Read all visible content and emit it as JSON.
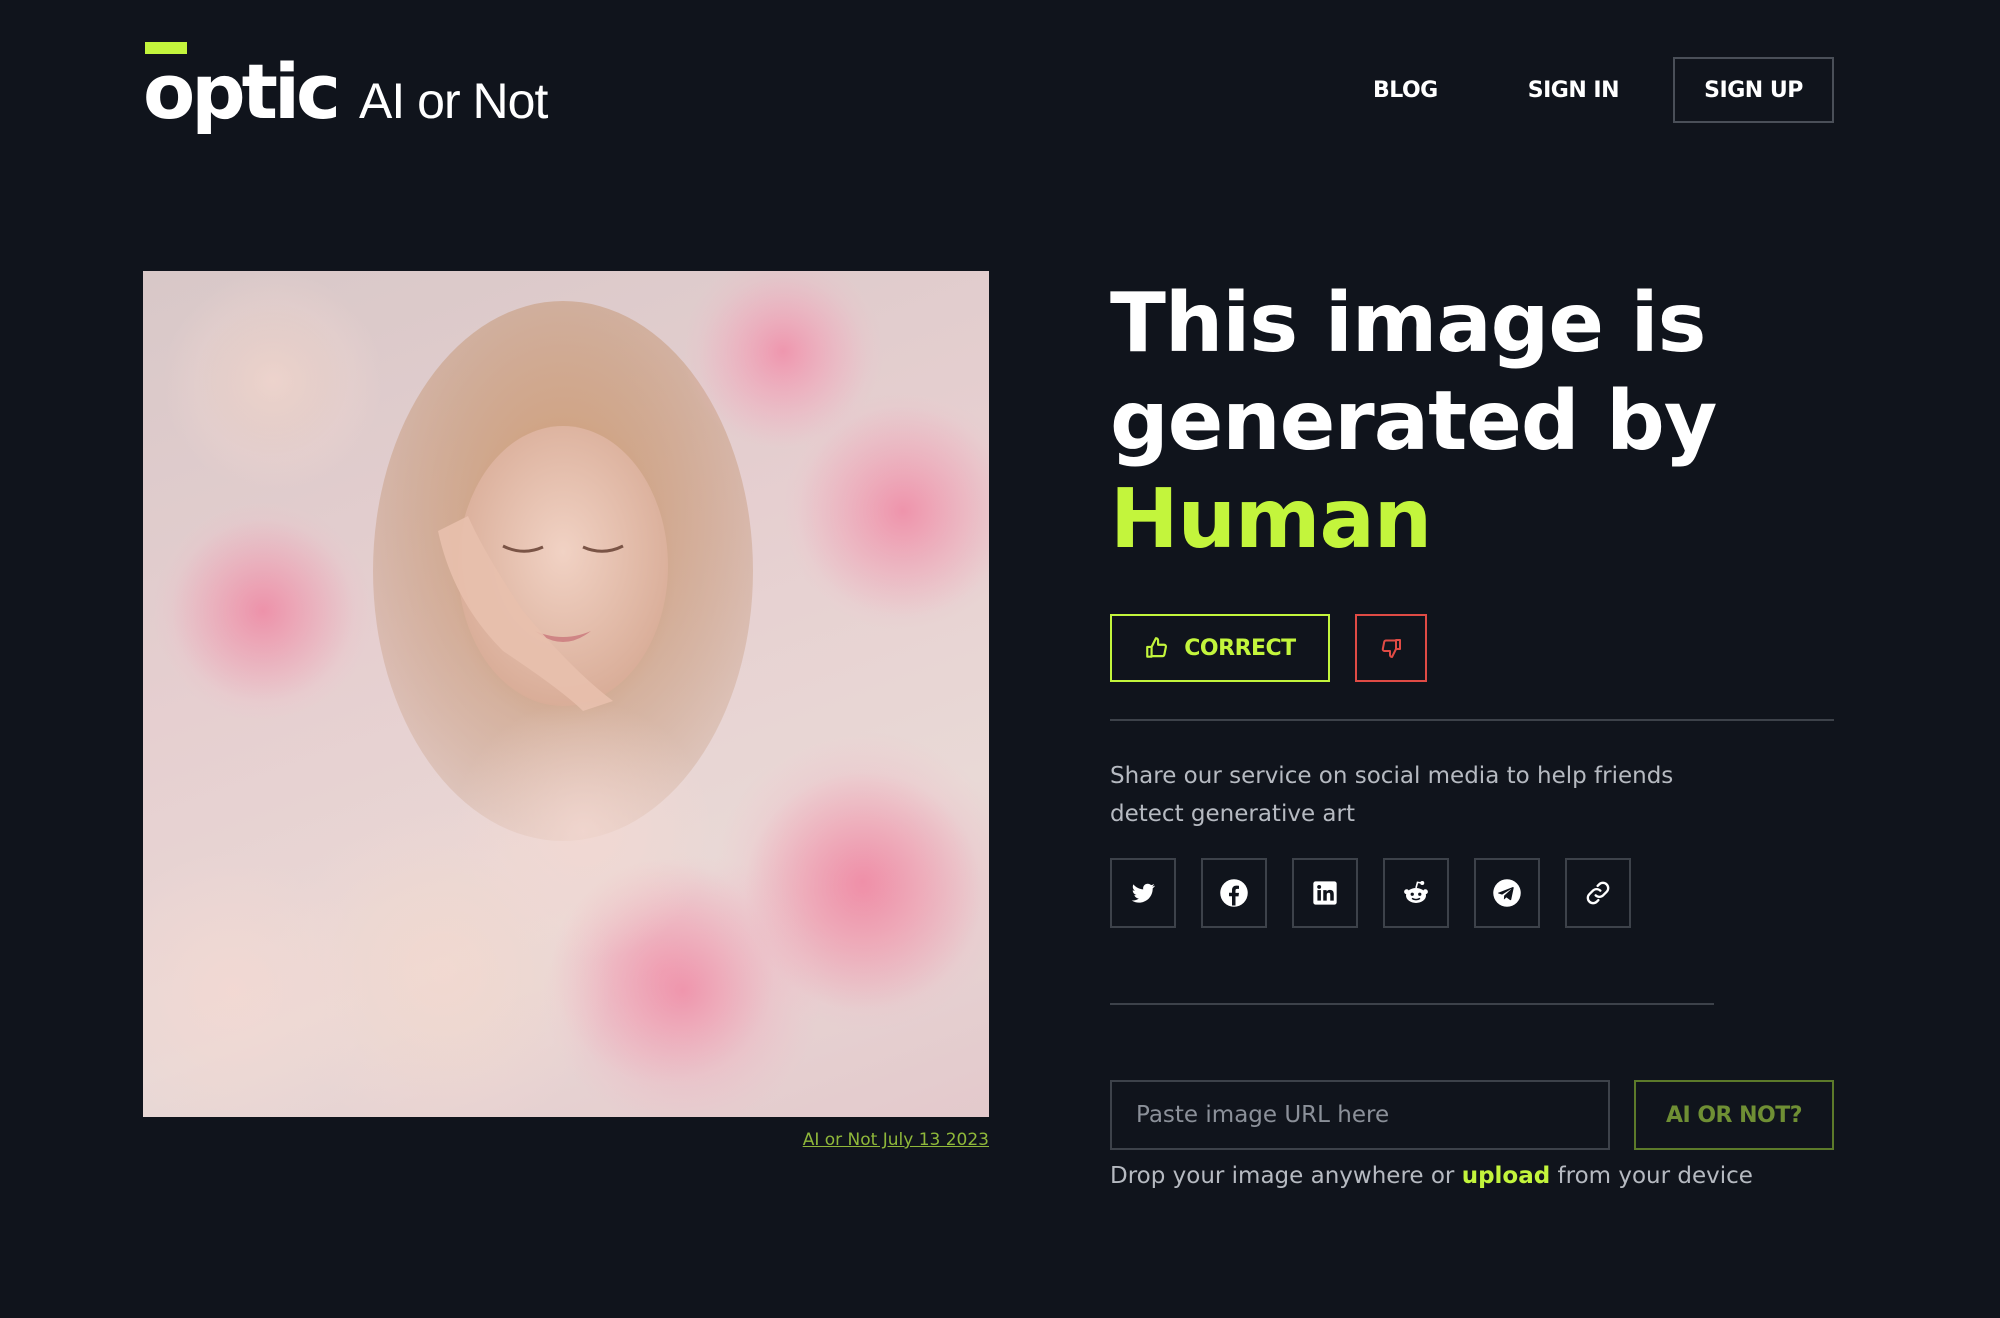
{
  "header": {
    "logo_text": "optic",
    "logo_subtitle": "AI or Not",
    "nav": {
      "blog": "BLOG",
      "sign_in": "SIGN IN",
      "sign_up": "SIGN UP"
    }
  },
  "image": {
    "caption": "AI or Not July 13 2023"
  },
  "result": {
    "headline": "This image is generated by",
    "verdict": "Human",
    "correct_label": "CORRECT"
  },
  "share": {
    "text": "Share our service on social media to help friends detect generative art",
    "icons": [
      "twitter-icon",
      "facebook-icon",
      "linkedin-icon",
      "reddit-icon",
      "telegram-icon",
      "link-icon"
    ]
  },
  "check": {
    "url_placeholder": "Paste image URL here",
    "url_value": "",
    "button_label": "AI OR NOT?",
    "drop_prefix": "Drop your image anywhere or",
    "upload_label": "upload",
    "drop_suffix": "from your device"
  },
  "colors": {
    "background": "#10141c",
    "accent": "#c3f53c",
    "danger": "#e04b45",
    "border": "#3d424a"
  }
}
